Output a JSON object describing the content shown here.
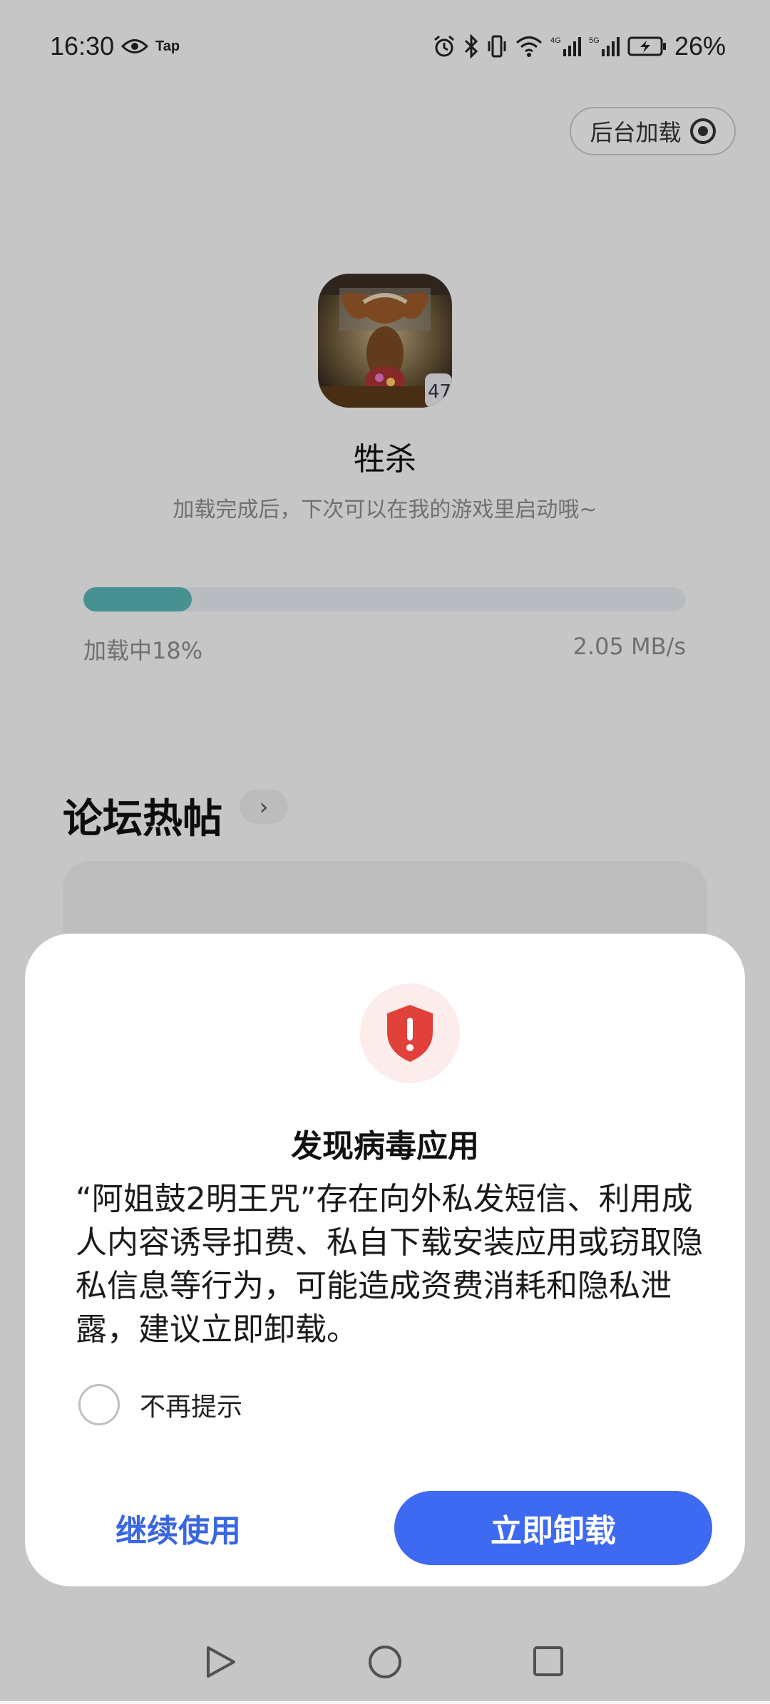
{
  "status_bar": {
    "time": "16:30",
    "tap_label": "Tap",
    "battery": "26%",
    "icons": [
      "eye-icon",
      "alarm-icon",
      "bluetooth-icon",
      "vibrate-icon",
      "wifi-icon",
      "signal-4g-icon",
      "signal-5g-icon",
      "battery-charging-icon"
    ]
  },
  "header": {
    "background_load_label": "后台加载"
  },
  "game": {
    "title": "牲杀",
    "subtitle": "加载完成后，下次可以在我的游戏里启动哦~",
    "badge": "47"
  },
  "progress": {
    "label": "加载中18%",
    "percent": 18,
    "speed": "2.05 MB/s",
    "fill_color": "#5ab6b8"
  },
  "forum": {
    "title": "论坛热帖",
    "arrow": "›"
  },
  "dialog": {
    "title": "发现病毒应用",
    "body": "“阿姐鼓2明王咒”存在向外私发短信、利用成人内容诱导扣费、私自下载安装应用或窃取隐私信息等行为，可能造成资费消耗和隐私泄露，建议立即卸载。",
    "no_remind_label": "不再提示",
    "no_remind_checked": false,
    "continue_label": "继续使用",
    "uninstall_label": "立即卸载",
    "accent_color": "#3d6af0",
    "warning_color": "#e2403a"
  },
  "nav_bar": {
    "icons": [
      "back-icon",
      "home-icon",
      "recents-icon"
    ]
  }
}
